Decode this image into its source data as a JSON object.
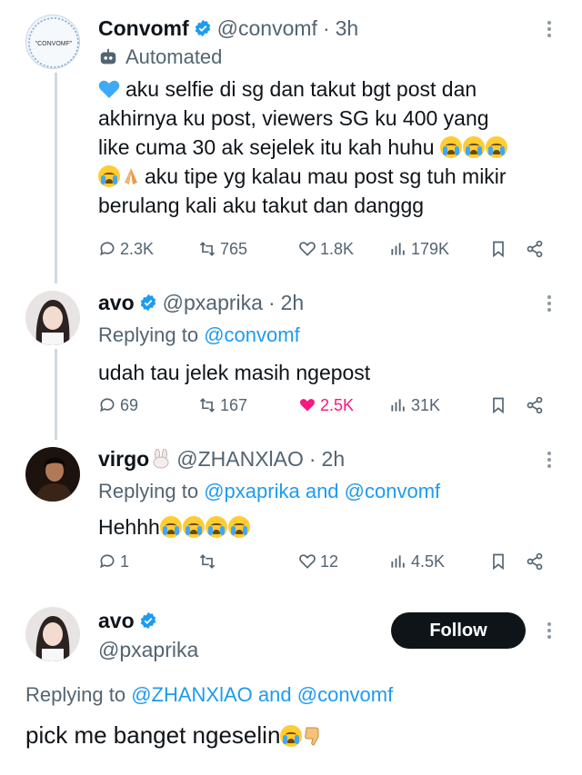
{
  "tweets": [
    {
      "name": "Convomf",
      "handle": "@convomf",
      "time": "3h",
      "automated_label": "Automated",
      "avatar_text": "\"CONVOMF\"",
      "text_lines": [
        "aku selfie di sg dan takut bgt post dan",
        "akhirnya ku post, viewers SG ku 400 yang",
        "like cuma 30 ak sejelek itu kah huhu",
        "aku tipe yg kalau mau post sg tuh mikir",
        "berulang kali aku takut dan danggg"
      ],
      "stats": {
        "replies": "2.3K",
        "retweets": "765",
        "likes": "1.8K",
        "views": "179K"
      }
    },
    {
      "name": "avo",
      "handle": "@pxaprika",
      "time": "2h",
      "replying_prefix": "Replying to",
      "replying_to": "@convomf",
      "text": "udah tau jelek masih ngepost",
      "stats": {
        "replies": "69",
        "retweets": "167",
        "likes": "2.5K",
        "views": "31K"
      }
    },
    {
      "name": "virgo",
      "handle": "@ZHANXlAO",
      "time": "2h",
      "replying_prefix": "Replying to",
      "replying_to_1": "@pxaprika",
      "replying_and": "and",
      "replying_to_2": "@convomf",
      "text": "Hehhh",
      "stats": {
        "replies": "1",
        "retweets": "",
        "likes": "12",
        "views": "4.5K"
      }
    },
    {
      "name": "avo",
      "handle": "@pxaprika",
      "follow_label": "Follow",
      "replying_prefix": "Replying to",
      "replying_to_1": "@ZHANXlAO",
      "replying_and": "and",
      "replying_to_2": "@convomf",
      "text": "pick me banget ngeselin"
    }
  ],
  "colors": {
    "accent": "#1d9bf0",
    "like": "#f91880",
    "muted": "#536471",
    "text": "#0f1419"
  }
}
